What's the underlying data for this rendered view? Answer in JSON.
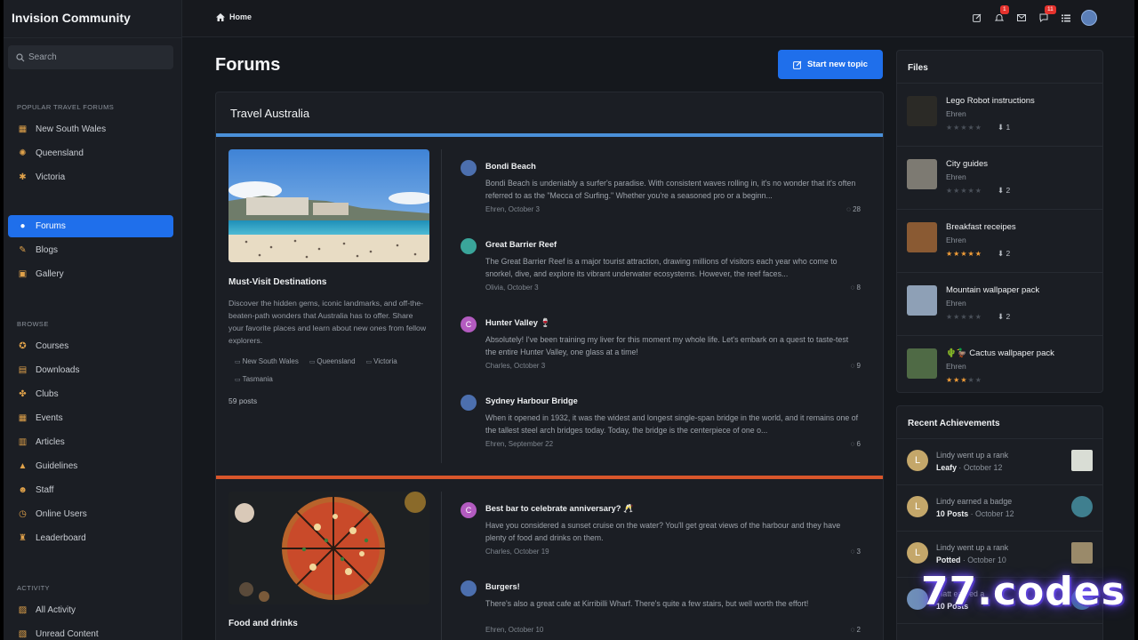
{
  "app": {
    "brand": "Invision Community"
  },
  "sidebar": {
    "search_placeholder": "Search",
    "sections": {
      "popular": "POPULAR TRAVEL FORUMS",
      "browse": "BROWSE",
      "activity": "ACTIVITY"
    },
    "popular_items": [
      {
        "label": "New South Wales",
        "icon": "nsw-icon",
        "glyph": "▦"
      },
      {
        "label": "Queensland",
        "icon": "sun-icon",
        "glyph": "✺"
      },
      {
        "label": "Victoria",
        "icon": "fireworks-icon",
        "glyph": "✱"
      }
    ],
    "main_items": [
      {
        "label": "Forums",
        "icon": "chat-icon",
        "glyph": "●"
      },
      {
        "label": "Blogs",
        "icon": "memo-icon",
        "glyph": "✎"
      },
      {
        "label": "Gallery",
        "icon": "camera-icon",
        "glyph": "▣"
      }
    ],
    "browse_items": [
      {
        "label": "Courses",
        "icon": "courses-icon",
        "glyph": "✪"
      },
      {
        "label": "Downloads",
        "icon": "floppy-icon",
        "glyph": "▤"
      },
      {
        "label": "Clubs",
        "icon": "clubs-icon",
        "glyph": "✤"
      },
      {
        "label": "Events",
        "icon": "calendar-icon",
        "glyph": "▦"
      },
      {
        "label": "Articles",
        "icon": "book-icon",
        "glyph": "▥"
      },
      {
        "label": "Guidelines",
        "icon": "warning-icon",
        "glyph": "▲"
      },
      {
        "label": "Staff",
        "icon": "smiley-icon",
        "glyph": "☻"
      },
      {
        "label": "Online Users",
        "icon": "clock-icon",
        "glyph": "◷"
      },
      {
        "label": "Leaderboard",
        "icon": "trophy-icon",
        "glyph": "♜"
      }
    ],
    "activity_items": [
      {
        "label": "All Activity",
        "icon": "chart-icon",
        "glyph": "▨"
      },
      {
        "label": "Unread Content",
        "icon": "unread-icon",
        "glyph": "▧"
      }
    ]
  },
  "topbar": {
    "breadcrumb": "Home",
    "notifications_count": "1",
    "messages_count": "11"
  },
  "main": {
    "title": "Forums",
    "new_topic": "Start new topic",
    "forum_group": "Travel Australia",
    "categories": [
      {
        "title": "Must-Visit Destinations",
        "description": "Discover the hidden gems, iconic landmarks, and off-the-beaten-path wonders that Australia has to offer. Share your favorite places and learn about new ones from fellow explorers.",
        "subforums": [
          "New South Wales",
          "Queensland",
          "Victoria",
          "Tasmania"
        ],
        "posts": "59 posts",
        "stripe_color": "#4a90d9",
        "topics": [
          {
            "title": "Bondi Beach",
            "body": "Bondi Beach is undeniably a surfer's paradise.  With consistent waves rolling in, it's no wonder that it's often referred to as the \"Mecca of Surfing.\" Whether you're a seasoned pro or a beginn...",
            "meta": "Ehren, October 3",
            "count": "28",
            "avatar_letter": "",
            "avatar_color": "#4c6fae"
          },
          {
            "title": "Great Barrier Reef",
            "body": "The Great Barrier Reef is a major tourist attraction, drawing millions of visitors each year who come to snorkel, dive, and explore its vibrant underwater ecosystems. However, the reef faces...",
            "meta": "Olivia, October 3",
            "count": "8",
            "avatar_letter": "",
            "avatar_color": "#3aa59a"
          },
          {
            "title": "Hunter Valley 🍷",
            "body": "Absolutely! I've been training my liver for this moment my whole life. Let's embark on a quest to taste-test the entire Hunter Valley, one glass at a time!",
            "meta": "Charles, October 3",
            "count": "9",
            "avatar_letter": "C",
            "avatar_color": "#b35bc0"
          },
          {
            "title": "Sydney Harbour Bridge",
            "body": "When it opened in 1932, it was the widest and longest single-span bridge in the world, and it remains one of the tallest steel arch bridges today. Today, the bridge is the centerpiece of one o...",
            "meta": "Ehren, September 22",
            "count": "6",
            "avatar_letter": "",
            "avatar_color": "#4c6fae"
          }
        ]
      },
      {
        "title": "Food and drinks",
        "stripe_color": "#d9562b",
        "topics": [
          {
            "title": "Best bar to celebrate anniversary? 🥂",
            "body": "Have you considered a sunset cruise on the water?  You'll get great views of the harbour and they have plenty of food and drinks on them.",
            "meta": "Charles, October 19",
            "count": "3",
            "avatar_letter": "C",
            "avatar_color": "#b35bc0"
          },
          {
            "title": "Burgers!",
            "body": "There's also a great cafe at Kirribilli Wharf. There's quite a few stairs, but well worth the effort!",
            "meta": "Ehren, October 10",
            "count": "2",
            "avatar_letter": "",
            "avatar_color": "#4c6fae"
          }
        ]
      }
    ]
  },
  "files": {
    "title": "Files",
    "items": [
      {
        "name": "Lego Robot instructions",
        "author": "Ehren",
        "rating": 0,
        "downloads": "1",
        "thumb": "#2b2a26"
      },
      {
        "name": "City guides",
        "author": "Ehren",
        "rating": 0,
        "downloads": "2",
        "thumb": "#7d7a72"
      },
      {
        "name": "Breakfast receipes",
        "author": "Ehren",
        "rating": 5,
        "downloads": "2",
        "thumb": "#8a5a33"
      },
      {
        "name": "Mountain wallpaper pack",
        "author": "Ehren",
        "rating": 0,
        "downloads": "2",
        "thumb": "#8ea0b6"
      },
      {
        "name": "🌵🦆 Cactus wallpaper pack",
        "author": "Ehren",
        "rating": 3,
        "downloads": "",
        "thumb": "#4f6a45"
      }
    ]
  },
  "achievements": {
    "title": "Recent Achievements",
    "items": [
      {
        "line1": "Lindy went up a rank",
        "name": "Leafy",
        "date": "October 12",
        "avatar": "L",
        "badge_color": "#d9ddd5"
      },
      {
        "line1": "Lindy earned a badge",
        "name": "10 Posts",
        "date": "October 12",
        "avatar": "L",
        "badge_color": "#3f7f8f"
      },
      {
        "line1": "Lindy went up a rank",
        "name": "Potted",
        "date": "October 10",
        "avatar": "L",
        "badge_color": "#9a8a6a"
      },
      {
        "line1": "Matt earned a",
        "name": "10 Posts",
        "date": "",
        "avatar": "",
        "badge_color": "#3f7f8f"
      }
    ]
  },
  "watermark": "77.codes"
}
